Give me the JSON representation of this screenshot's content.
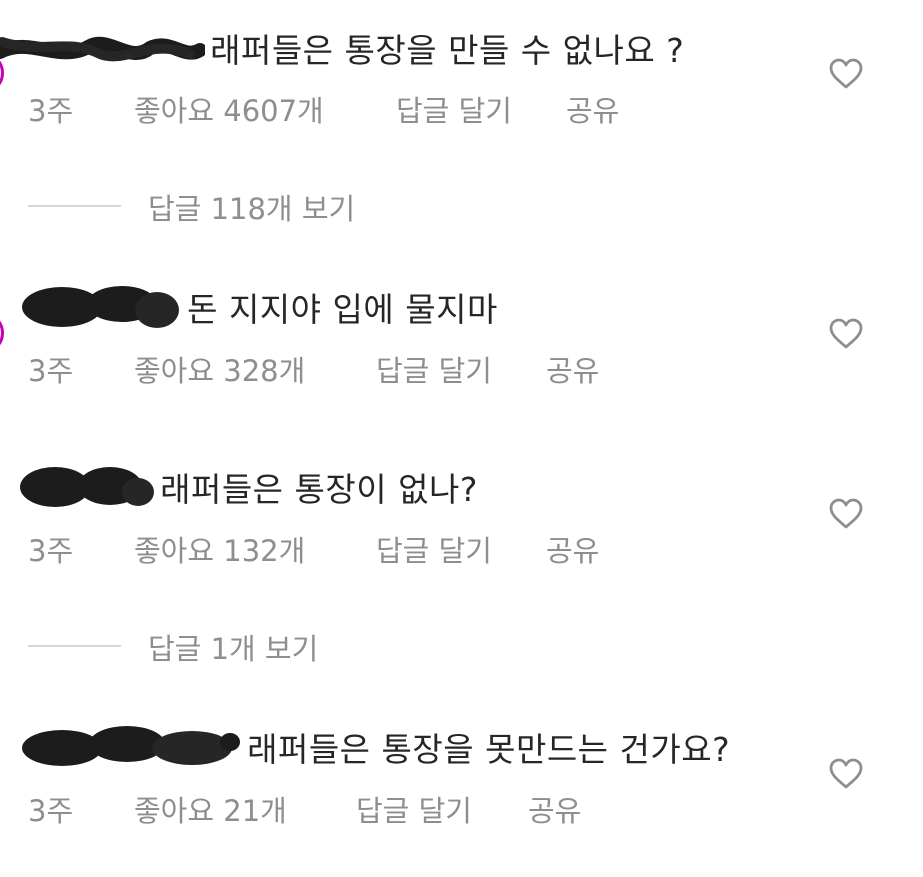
{
  "comments": [
    {
      "text": "래퍼들은 통장을 만들 수 없나요 ?",
      "time": "3주",
      "likes": "좋아요 4607개",
      "reply": "답글 달기",
      "share": "공유"
    },
    {
      "text": "돈 지지야 입에 물지마",
      "time": "3주",
      "likes": "좋아요 328개",
      "reply": "답글 달기",
      "share": "공유"
    },
    {
      "text": "래퍼들은 통장이 없나?",
      "time": "3주",
      "likes": "좋아요 132개",
      "reply": "답글 달기",
      "share": "공유"
    },
    {
      "text": "래퍼들은 통장을 못만드는 건가요?",
      "time": "3주",
      "likes": "좋아요 21개",
      "reply": "답글 달기",
      "share": "공유"
    }
  ],
  "view_replies": [
    "답글 118개 보기",
    "답글 1개 보기"
  ],
  "icons": {
    "like": "heart-outline-icon",
    "username_redaction": "scribble-redaction"
  },
  "colors": {
    "text": "#262626",
    "muted": "#8e8e8e",
    "story_ring": "#c400b8",
    "divider": "#d7d7d7"
  }
}
